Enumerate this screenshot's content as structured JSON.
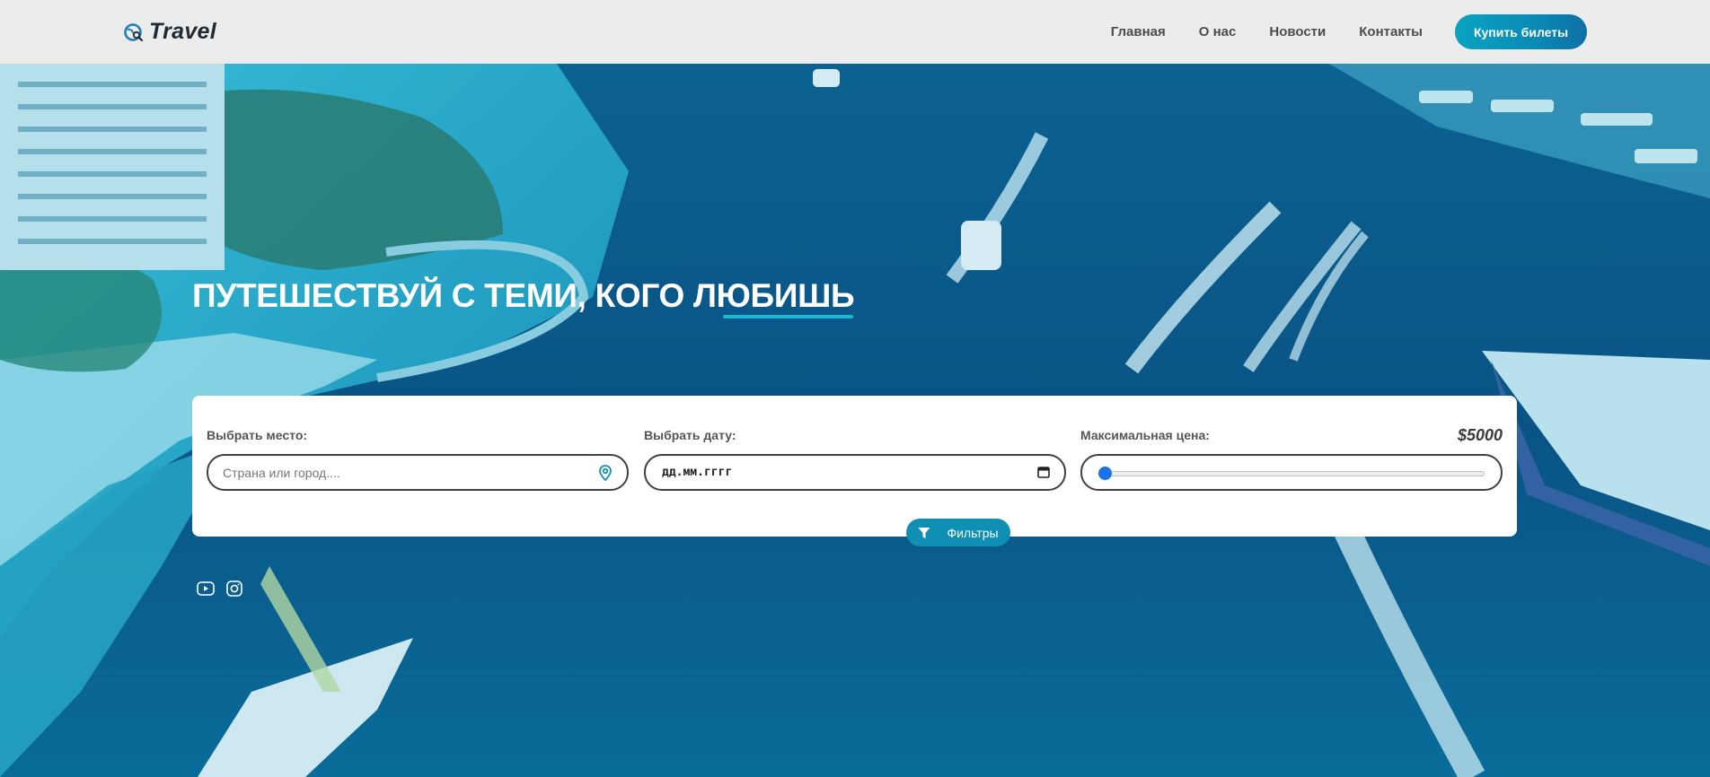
{
  "header": {
    "logo_text": "Travel",
    "nav": [
      "Главная",
      "О нас",
      "Новости",
      "Контакты"
    ],
    "buy_button": "Купить билеты"
  },
  "hero": {
    "title": "ПУТЕШЕСТВУЙ С ТЕМИ, КОГО ЛЮБИШЬ"
  },
  "search": {
    "place_label": "Выбрать место:",
    "place_placeholder": "Страна или город....",
    "date_label": "Выбрать дату:",
    "date_placeholder": "дд.мм.гггг",
    "price_label": "Максимальная цена:",
    "price_value": "$5000",
    "price_slider_fraction": 0.0
  },
  "filters_button": "Фильтры",
  "social": [
    "youtube-icon",
    "instagram-icon"
  ],
  "colors": {
    "accent": "#0f8fb3",
    "header_bg": "#ececec",
    "slider_thumb": "#1a73e8"
  }
}
